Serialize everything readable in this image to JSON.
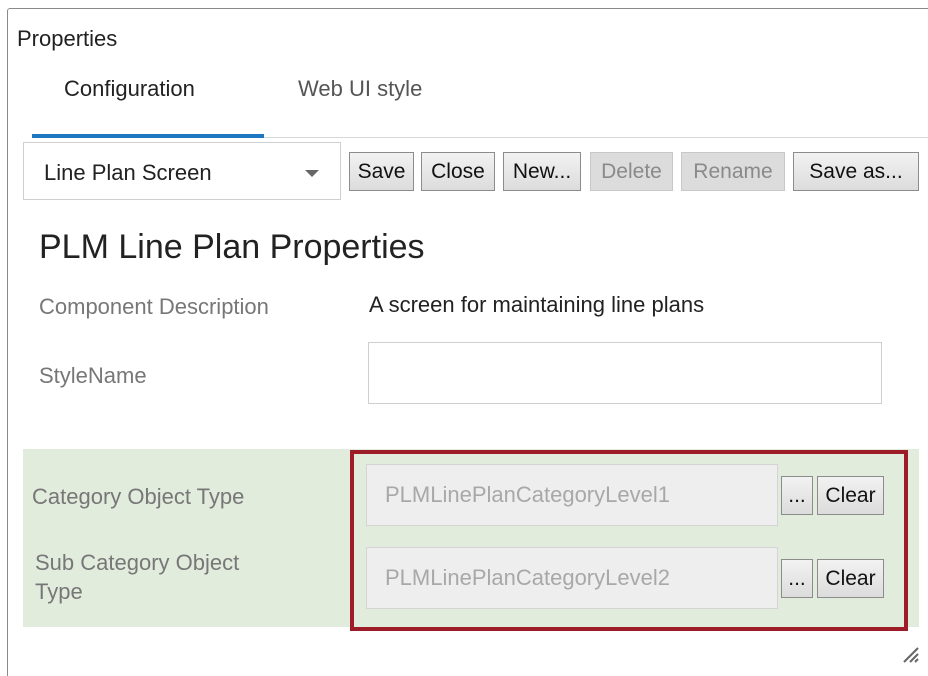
{
  "panel": {
    "title": "Properties"
  },
  "tabs": [
    {
      "label": "Configuration",
      "active": true
    },
    {
      "label": "Web UI style",
      "active": false
    }
  ],
  "toolbar": {
    "selector_value": "Line Plan Screen",
    "buttons": [
      {
        "label": "Save",
        "enabled": true
      },
      {
        "label": "Close",
        "enabled": true
      },
      {
        "label": "New...",
        "enabled": true
      },
      {
        "label": "Delete",
        "enabled": false
      },
      {
        "label": "Rename",
        "enabled": false
      },
      {
        "label": "Save as...",
        "enabled": true
      }
    ]
  },
  "content": {
    "heading": "PLM Line Plan Properties",
    "component_description_label": "Component Description",
    "component_description_value": "A screen for maintaining line plans",
    "stylename_label": "StyleName",
    "stylename_value": "",
    "category_label": "Category Object Type",
    "category_value": "PLMLinePlanCategoryLevel1",
    "subcategory_label_line1": "Sub Category Object",
    "subcategory_label_line2": "Type",
    "subcategory_value": "PLMLinePlanCategoryLevel2",
    "browse_label": "...",
    "clear_label": "Clear"
  },
  "colors": {
    "accent": "#1d77c0",
    "highlight_border": "#9c1c28",
    "group_background": "#e2ecdd"
  },
  "icons": {
    "dropdown": "chevron-down-icon",
    "resize": "resize-grip-icon"
  }
}
